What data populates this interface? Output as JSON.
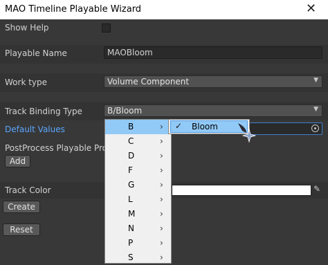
{
  "window": {
    "title": "MAO Timeline Playable Wizard",
    "close_glyph": "✕"
  },
  "form": {
    "show_help_label": "Show Help",
    "show_help_checked": false,
    "playable_name_label": "Playable Name",
    "playable_name_value": "MAOBloom",
    "work_type_label": "Work type",
    "work_type_value": "Volume Component",
    "track_binding_label": "Track Binding Type",
    "track_binding_value": "B/Bloom",
    "default_values_label": "Default Values",
    "postprocess_label": "PostProcess Playable Prop",
    "add_button": "Add",
    "track_color_label": "Track Color",
    "track_color_value": "#ffffff",
    "create_button": "Create",
    "reset_button": "Reset"
  },
  "menu": {
    "items": [
      "B",
      "C",
      "D",
      "F",
      "G",
      "L",
      "M",
      "N",
      "P",
      "S"
    ],
    "highlighted": "B",
    "chevron": "›"
  },
  "submenu": {
    "item": "Bloom",
    "checked": true,
    "check_glyph": "✓"
  },
  "colors": {
    "accent_blue": "#5aa6ff",
    "highlight": "#91c9f7",
    "panel_bg": "#383838"
  }
}
